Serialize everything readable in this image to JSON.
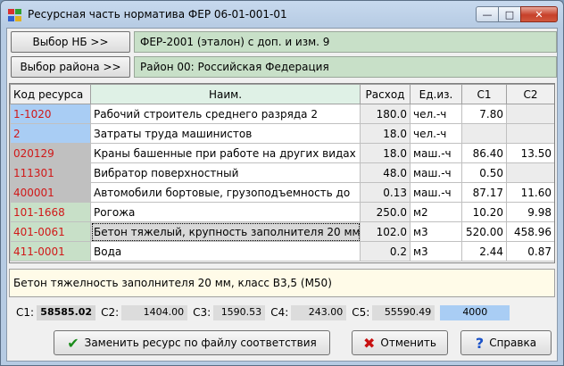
{
  "window": {
    "title": "Ресурсная часть норматива ФЕР 06-01-001-01",
    "minimize_glyph": "—",
    "maximize_glyph": "□",
    "close_glyph": "✕",
    "icon_colors": [
      "#d83030",
      "#30a030",
      "#3060d0",
      "#e0b020"
    ]
  },
  "selectors": {
    "nb_button": "Выбор НБ >>",
    "nb_value": "ФЕР-2001 (эталон) с доп. и изм.  9",
    "region_button": "Выбор района >>",
    "region_value": "Район 00: Российская Федерация"
  },
  "grid": {
    "headers": [
      "Код ресурса",
      "Наим.",
      "Расход",
      "Ед.из.",
      "С1",
      "С2"
    ],
    "rows": [
      {
        "code": "1-1020",
        "name": "Рабочий строитель среднего разряда 2",
        "qty": "180.0",
        "unit": "чел.-ч",
        "c1": "7.80",
        "c2": "",
        "code_bg": "#a9cdf4",
        "code_color": "#d01818",
        "c1_bg": "#fff",
        "c2_bg": "#ececec"
      },
      {
        "code": "2",
        "name": "Затраты труда машинистов",
        "qty": "18.0",
        "unit": "чел.-ч",
        "c1": "",
        "c2": "",
        "code_bg": "#a9cdf4",
        "code_color": "#d01818",
        "c1_bg": "#ececec",
        "c2_bg": "#ececec"
      },
      {
        "code": "020129",
        "name": "Краны башенные при работе на других видах",
        "qty": "18.0",
        "unit": "маш.-ч",
        "c1": "86.40",
        "c2": "13.50",
        "code_bg": "#c0c0c0",
        "code_color": "#d01818",
        "c1_bg": "#fff",
        "c2_bg": "#fff"
      },
      {
        "code": "111301",
        "name": "Вибратор поверхностный",
        "qty": "48.0",
        "unit": "маш.-ч",
        "c1": "0.50",
        "c2": "",
        "code_bg": "#c0c0c0",
        "code_color": "#d01818",
        "c1_bg": "#fff",
        "c2_bg": "#ececec"
      },
      {
        "code": "400001",
        "name": "Автомобили бортовые, грузоподъемность до",
        "qty": "0.13",
        "unit": "маш.-ч",
        "c1": "87.17",
        "c2": "11.60",
        "code_bg": "#c0c0c0",
        "code_color": "#d01818",
        "c1_bg": "#fff",
        "c2_bg": "#fff"
      },
      {
        "code": "101-1668",
        "name": "Рогожа",
        "qty": "250.0",
        "unit": "м2",
        "c1": "10.20",
        "c2": "9.98",
        "code_bg": "#c8e0c8",
        "code_color": "#d01818",
        "c1_bg": "#fff",
        "c2_bg": "#fff"
      },
      {
        "code": "401-0061",
        "name": "Бетон тяжелый, крупность заполнителя 20 мм",
        "qty": "102.0",
        "unit": "м3",
        "c1": "520.00",
        "c2": "458.96",
        "code_bg": "#c8e0c8",
        "code_color": "#d01818",
        "c1_bg": "#fff",
        "c2_bg": "#fff",
        "selected": true
      },
      {
        "code": "411-0001",
        "name": "Вода",
        "qty": "0.2",
        "unit": "м3",
        "c1": "2.44",
        "c2": "0.87",
        "code_bg": "#c8e0c8",
        "code_color": "#d01818",
        "c1_bg": "#fff",
        "c2_bg": "#fff"
      }
    ]
  },
  "description": "Бетон тяжелность заполнителя 20 мм, класс В3,5 (М50)",
  "totals": {
    "c1_label": "С1:",
    "c1_value": "58585.02",
    "c2_label": "С2:",
    "c2_value": "1404.00",
    "c3_label": "С3:",
    "c3_value": "1590.53",
    "c4_label": "С4:",
    "c4_value": "243.00",
    "c5_label": "С5:",
    "c5_value": "55590.49",
    "extra_value": "4000"
  },
  "buttons": {
    "replace": "Заменить ресурс по файлу соответствия",
    "cancel": "Отменить",
    "help": "Справка",
    "replace_icon": "✔",
    "cancel_icon": "✖",
    "help_icon": "?"
  }
}
